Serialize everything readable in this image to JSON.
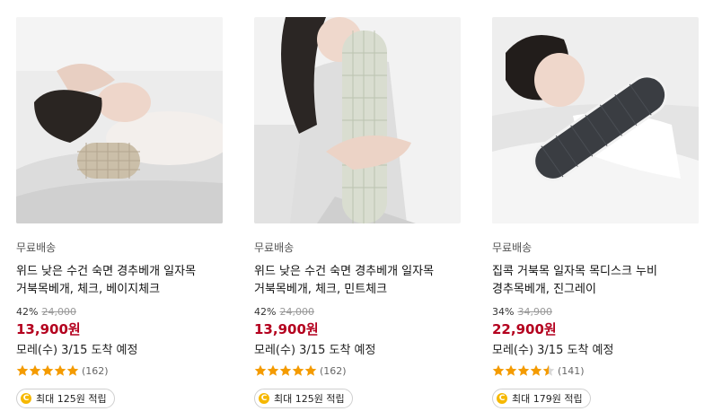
{
  "products": [
    {
      "image_alt": "beige check neck roll pillow",
      "shipping": "무료배송",
      "title": "위드 낮은 수건 숙면 경추베개 일자목 거북목베개, 체크, 베이지체크",
      "discount": "42%",
      "original_price": "24,000",
      "price": "13,900원",
      "delivery": "모레(수) 3/15 도착 예정",
      "rating": 5,
      "review_count": "(162)",
      "cash_reward": "최대 125원 적립"
    },
    {
      "image_alt": "mint check long neck pillow",
      "shipping": "무료배송",
      "title": "위드 낮은 수건 숙면 경추베개 일자목 거북목베개, 체크, 민트체크",
      "discount": "42%",
      "original_price": "24,000",
      "price": "13,900원",
      "delivery": "모레(수) 3/15 도착 예정",
      "rating": 5,
      "review_count": "(162)",
      "cash_reward": "최대 125원 적립"
    },
    {
      "image_alt": "dark gray neck disc roll pillow",
      "shipping": "무료배송",
      "title": "집콕 거북목 일자목 목디스크 누비 경추목베개, 진그레이",
      "discount": "34%",
      "original_price": "34,900",
      "price": "22,900원",
      "delivery": "모레(수) 3/15 도착 예정",
      "rating": 4.5,
      "review_count": "(141)",
      "cash_reward": "최대 179원 적립"
    }
  ],
  "coin_glyph": "C",
  "colors": {
    "price": "#b4001e",
    "star": "#f49b00",
    "coin": "#f6b800"
  }
}
